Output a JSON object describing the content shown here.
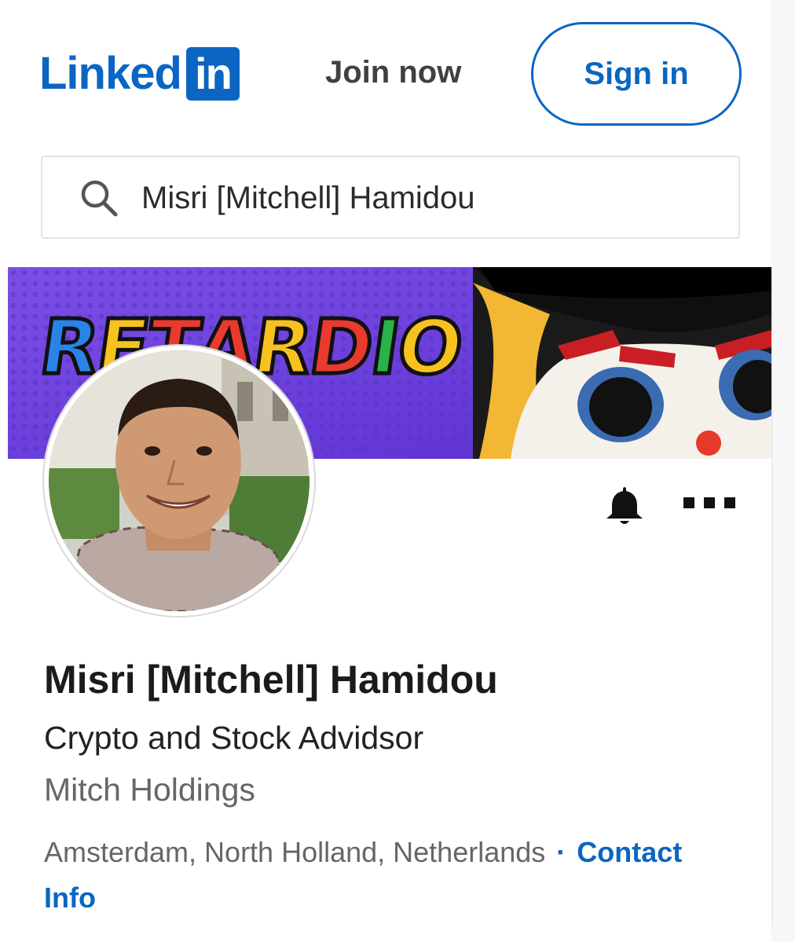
{
  "header": {
    "logo_text": "Linked",
    "logo_box_text": "in",
    "join_now_label": "Join now",
    "sign_in_label": "Sign in"
  },
  "search": {
    "value": "Misri [Mitchell] Hamidou",
    "icon": "search-icon"
  },
  "banner": {
    "title_letters": [
      "R",
      "E",
      "T",
      "A",
      "R",
      "D",
      "I",
      "O"
    ]
  },
  "profile": {
    "name": "Misri [Mitchell] Hamidou",
    "headline": "Crypto and Stock Advidsor",
    "company": "Mitch Holdings",
    "location": "Amsterdam, North Holland, Netherlands",
    "separator": "·",
    "contact_label": "Contact Info"
  },
  "actions": {
    "bell_icon": "bell-icon",
    "more_icon": "more-icon"
  },
  "colors": {
    "brand": "#0a66c2",
    "banner_bg": "#6a3fd8"
  }
}
